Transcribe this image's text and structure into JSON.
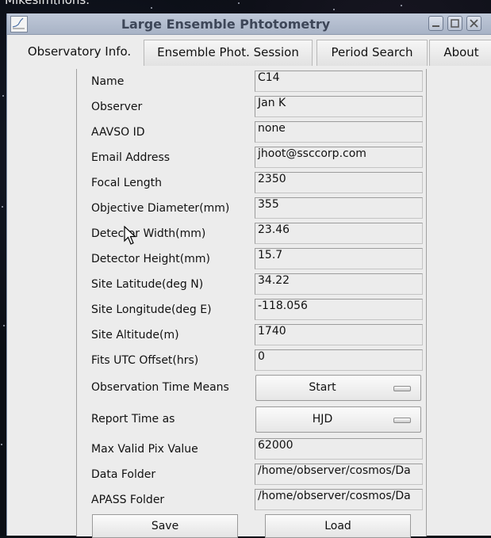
{
  "background_label": "Mikesimmons.",
  "window": {
    "title": "Large Ensemble Phtotometry",
    "controls": [
      "minimize-icon",
      "maximize-icon",
      "close-icon"
    ]
  },
  "tabs": [
    {
      "label": "Observatory Info.",
      "active": true
    },
    {
      "label": "Ensemble Phot. Session",
      "active": false
    },
    {
      "label": "Period Search",
      "active": false
    },
    {
      "label": "About",
      "active": false
    }
  ],
  "form": {
    "fields": [
      {
        "label": "Name",
        "value": "C14"
      },
      {
        "label": "Observer",
        "value": "Jan K"
      },
      {
        "label": "AAVSO ID",
        "value": "none"
      },
      {
        "label": "Email Address",
        "value": "jhoot@ssccorp.com"
      },
      {
        "label": "Focal Length",
        "value": "2350"
      },
      {
        "label": "Objective Diameter(mm)",
        "value": "355"
      },
      {
        "label": "Detector Width(mm)",
        "value": "23.46"
      },
      {
        "label": "Detector Height(mm)",
        "value": "15.7"
      },
      {
        "label": "Site Latitude(deg N)",
        "value": "34.22"
      },
      {
        "label": "Site Longitude(deg E)",
        "value": "-118.056"
      },
      {
        "label": "Site Altitude(m)",
        "value": "1740"
      },
      {
        "label": "Fits UTC Offset(hrs)",
        "value": "0"
      }
    ],
    "observation_time": {
      "label": "Observation Time Means",
      "value": "Start"
    },
    "report_time": {
      "label": "Report Time as",
      "value": "HJD"
    },
    "max_pix": {
      "label": "Max Valid Pix Value",
      "value": "62000"
    },
    "data_folder": {
      "label": "Data Folder",
      "value": "/home/observer/cosmos/Da"
    },
    "apass_folder": {
      "label": "APASS Folder",
      "value": "/home/observer/cosmos/Da"
    }
  },
  "buttons": {
    "save": "Save",
    "load": "Load"
  },
  "colors": {
    "titlebar": "#b4bed0",
    "panel": "#ececec",
    "title_text": "#3d4658"
  }
}
